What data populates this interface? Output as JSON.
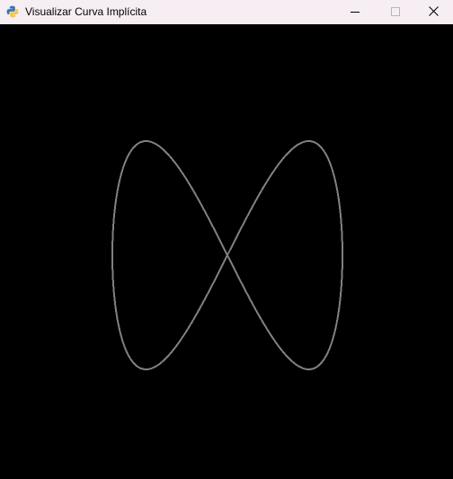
{
  "window": {
    "title": "Visualizar Curva Implícita",
    "app_icon": "python-icon",
    "controls": {
      "minimize_icon": "minimize-icon",
      "maximize_icon": "maximize-icon",
      "close_icon": "close-icon"
    }
  },
  "canvas": {
    "background_color": "#000000",
    "curve_color": "#808080",
    "curve_shape": "figure-eight"
  }
}
